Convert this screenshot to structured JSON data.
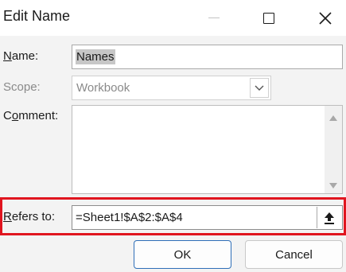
{
  "window": {
    "title": "Edit Name",
    "controls": {
      "minimize_icon": "minimize-icon",
      "maximize_icon": "maximize-icon",
      "close_icon": "close-icon"
    }
  },
  "form": {
    "name": {
      "label_underlined": "N",
      "label_rest": "ame:",
      "value": "Names"
    },
    "scope": {
      "label": "Scope:",
      "value": "Workbook",
      "disabled": true
    },
    "comment": {
      "label_prefix": "C",
      "label_underlined": "o",
      "label_rest": "mment:",
      "value": ""
    },
    "refers_to": {
      "label_underlined": "R",
      "label_rest": "efers to:",
      "value": "=Sheet1!$A$2:$A$4",
      "highlighted": true
    }
  },
  "buttons": {
    "ok": "OK",
    "cancel": "Cancel"
  },
  "colors": {
    "highlight": "#e0151f",
    "primary_border": "#2f6fb8",
    "disabled_text": "#8a8a8a"
  }
}
